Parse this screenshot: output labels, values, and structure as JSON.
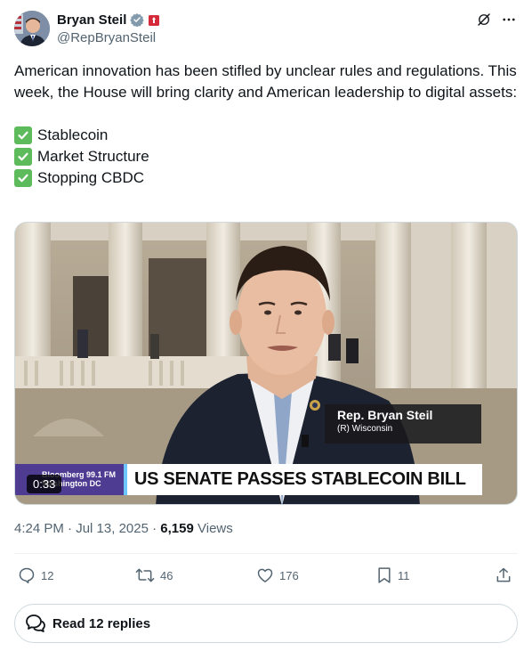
{
  "author": {
    "name": "Bryan Steil",
    "handle": "@RepBryanSteil"
  },
  "tweet": {
    "paragraph": "American innovation has been stifled by unclear rules and regulations. This week, the House will bring clarity and American leadership to digital assets:",
    "checklist": [
      "Stablecoin",
      "Market Structure",
      "Stopping CBDC"
    ]
  },
  "media": {
    "duration": "0:33",
    "lower_third_name": "Rep. Bryan Steil",
    "lower_third_party": "(R) Wisconsin",
    "ticker_left_line1": "Bloomberg 99.1 FM",
    "ticker_left_line2": "Washington DC",
    "ticker_headline": "US SENATE PASSES STABLECOIN BILL"
  },
  "meta": {
    "time": "4:24 PM",
    "date": "Jul 13, 2025",
    "separator": "·",
    "views_count": "6,159",
    "views_label": "Views"
  },
  "actions": {
    "replies": "12",
    "reposts": "46",
    "likes": "176",
    "bookmarks": "11"
  },
  "read_replies": "Read 12 replies",
  "colors": {
    "text": "#0f1419",
    "secondary": "#536471",
    "verified": "#829aab",
    "check": "#5dbb5b",
    "ticker_purple": "#4e3c93"
  }
}
